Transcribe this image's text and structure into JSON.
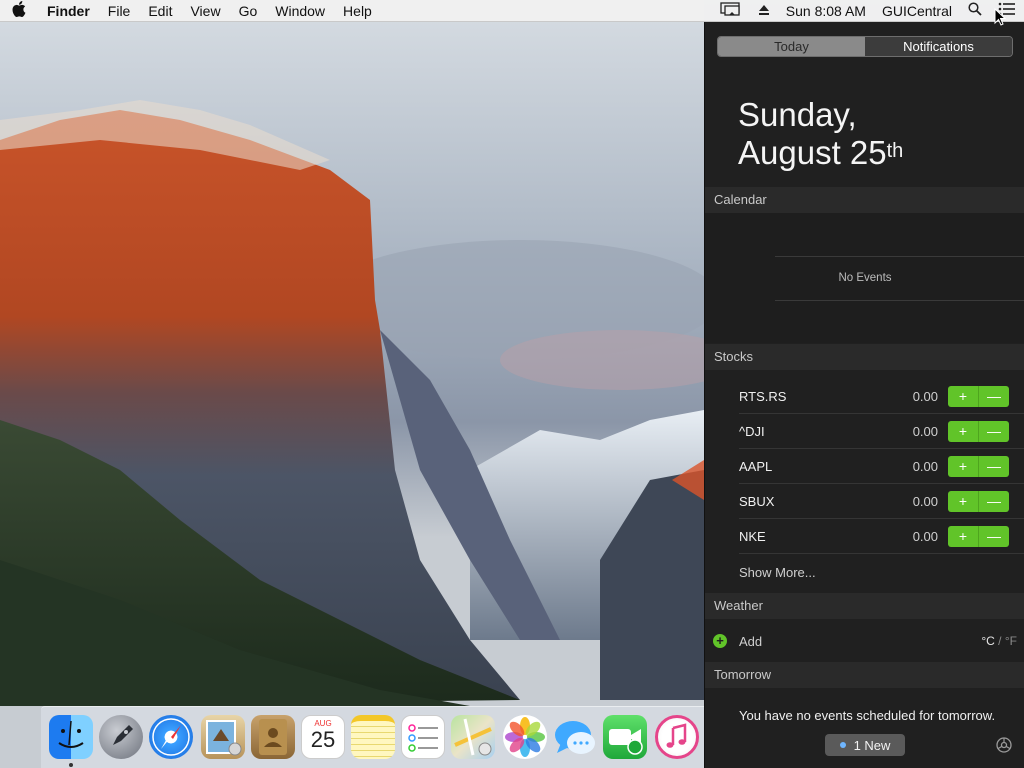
{
  "menubar": {
    "apple_icon": "apple-logo-icon",
    "app_name": "Finder",
    "menus": [
      "File",
      "Edit",
      "View",
      "Go",
      "Window",
      "Help"
    ],
    "status": {
      "display_icon": "airplay-display-icon",
      "eject_icon": "eject-icon",
      "clock": "Sun 8:08 AM",
      "user": "GUICentral",
      "spotlight_icon": "search-icon",
      "nc_icon": "notification-center-icon"
    }
  },
  "notification_center": {
    "tabs": {
      "today": "Today",
      "notifications": "Notifications",
      "active": "Notifications"
    },
    "date_line1": "Sunday,",
    "date_line2": "August 25",
    "date_suffix": "th",
    "calendar": {
      "header": "Calendar",
      "empty_text": "No Events"
    },
    "stocks": {
      "header": "Stocks",
      "rows": [
        {
          "symbol": "RTS.RS",
          "value": "0.00"
        },
        {
          "symbol": "^DJI",
          "value": "0.00"
        },
        {
          "symbol": "AAPL",
          "value": "0.00"
        },
        {
          "symbol": "SBUX",
          "value": "0.00"
        },
        {
          "symbol": "NKE",
          "value": "0.00"
        }
      ],
      "plus": "+",
      "minus": "—",
      "show_more": "Show More..."
    },
    "weather": {
      "header": "Weather",
      "add_label": "Add",
      "unit_c": "°C",
      "unit_sep": " / ",
      "unit_f": "°F"
    },
    "tomorrow": {
      "header": "Tomorrow",
      "text": "You have no events scheduled for tomorrow."
    },
    "footer": {
      "new_label": "1 New",
      "settings_icon": "gear-icon"
    }
  },
  "dock": {
    "apps": [
      "Finder",
      "Launchpad",
      "Safari",
      "Mail",
      "Contacts",
      "Calendar",
      "Notes",
      "Reminders",
      "Maps",
      "Photos",
      "Messages",
      "FaceTime",
      "iTunes"
    ],
    "calendar_month": "AUG",
    "calendar_day": "25"
  },
  "colors": {
    "accent_green": "#61c429",
    "nc_background": "#202020",
    "menubar_bg": "#f0f0f0"
  }
}
